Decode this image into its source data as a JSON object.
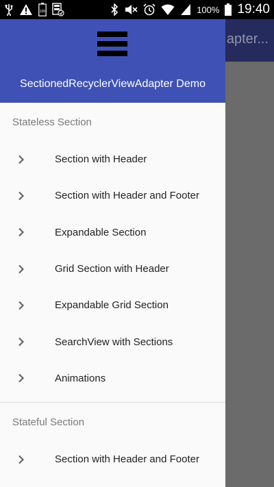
{
  "status_bar": {
    "battery_percent": "100%",
    "time": "19:40",
    "battery_indicator_text": "100"
  },
  "app_bar": {
    "title_partial": "apter..."
  },
  "drawer": {
    "header_title": "SectionedRecyclerViewAdapter Demo",
    "sections": [
      {
        "label": "Stateless Section",
        "items": [
          "Section with Header",
          "Section with Header and Footer",
          "Expandable Section",
          "Grid Section with Header",
          "Expandable Grid Section",
          "SearchView with Sections",
          "Animations"
        ]
      },
      {
        "label": "Stateful Section",
        "items": [
          "Section with Header and Footer"
        ]
      }
    ]
  },
  "colors": {
    "header": "#3f51b5",
    "app_bar": "#252b5d",
    "drawer_bg": "#fafafa",
    "scrim": "#6b6b6b"
  }
}
